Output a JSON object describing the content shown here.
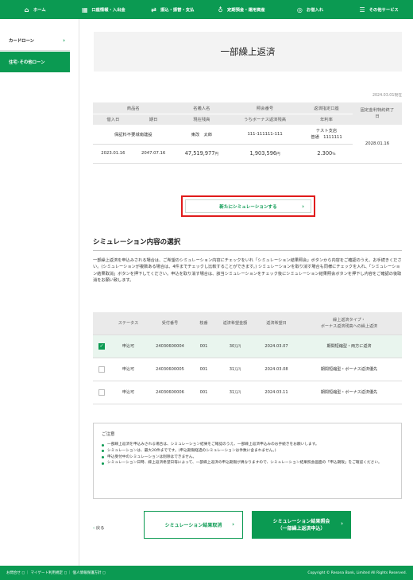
{
  "nav": [
    {
      "label": "ホーム",
      "icon": "home-icon",
      "glyph": "⌂"
    },
    {
      "label": "口座情報・入出金",
      "icon": "bank-icon",
      "glyph": "▦"
    },
    {
      "label": "振込・振替・支払",
      "icon": "transfer-icon",
      "glyph": "⇄"
    },
    {
      "label": "定期預金・運用資産",
      "icon": "savings-icon",
      "glyph": "♁"
    },
    {
      "label": "お借入れ",
      "icon": "loan-icon",
      "glyph": "◎"
    },
    {
      "label": "その他サービス",
      "icon": "services-icon",
      "glyph": "☰"
    }
  ],
  "sidebar": {
    "items": [
      {
        "label": "カードローン"
      },
      {
        "label": "住宅･その他ローン"
      }
    ]
  },
  "page_title": "一部繰上返済",
  "as_of": "2024.03.01現在",
  "loan_table": {
    "headers_row1": [
      "商品名",
      "名義人名",
      "照会番号",
      "返済指定口座",
      "固定金利特約終了日"
    ],
    "headers_row2": [
      "借入日",
      "期日",
      "現在残高",
      "うちボーナス返済残高",
      "年利率"
    ],
    "product": "保証料不要城南建設",
    "holder": "東改　太郎",
    "ref_no": "111-111111-111",
    "account_line1": "テスト支店",
    "account_line2": "普通　1111111",
    "fixed_end": "2028.01.16",
    "borrow_date": "2023.01.16",
    "due_date": "2047.07.16",
    "balance": "47,519,977",
    "bonus_balance": "1,903,596",
    "rate": "2.300",
    "unit_yen": "円",
    "unit_pct": "%"
  },
  "new_sim_button": "新たにシミュレーションする",
  "section_title": "シミュレーション内容の選択",
  "description": "一部繰上返済を申込みされる場合は、ご希望のシミュレーション内容にチェックをいれ「シミュレーション結果照会」ボタンから内容をご確認のうえ、お手続きください。(シミュレーションが複数ある場合は、4件までチェックし比較することができます。) シミュレーションを取り消す場合も同様にチェックを入れ、「シミュレーション結果取消」ボタンを押下してください。申込を取り消す場合は、該当シミュレーションをチェック後にシミュレーション結果照会ボタンを押下し内容をご確認の後取消をお願い致します。",
  "sim_table": {
    "headers": [
      "ステータス",
      "受付番号",
      "枝番",
      "返済希望金額",
      "返済希望日",
      "繰上返済タイプ・\nボーナス返済残高への繰上返済"
    ],
    "rows": [
      {
        "checked": true,
        "status": "申込可",
        "ref": "24030600004",
        "branch": "001",
        "amount": "30",
        "unit": "万円",
        "date": "2024.03.07",
        "type": "期間短縮型・両方に返済"
      },
      {
        "checked": false,
        "status": "申込可",
        "ref": "24030600005",
        "branch": "001",
        "amount": "31",
        "unit": "万円",
        "date": "2024.03.08",
        "type": "期間短縮型・ボーナス返済優先"
      },
      {
        "checked": false,
        "status": "申込可",
        "ref": "24030600006",
        "branch": "001",
        "amount": "31",
        "unit": "万円",
        "date": "2024.03.11",
        "type": "期間短縮型・ボーナス返済優先"
      }
    ]
  },
  "notice": {
    "title": "ご注意",
    "items": [
      "一部繰上返済を申込みされる場合は、シミュレーション結果をご確認のうえ、一部繰上返済申込みのお手続きをお願いします。",
      "シミュレーションは、最大20件までです。(申込期限経過のシミュレーションは件数に含まれません。)",
      "申込受付中のシミュレーションは削除はできません。",
      "シミュレーション日時、繰上返済希望日等によって、一部繰上返済の申込期限が異なりますので、シミュレーション結果照会画面の「申込期限」をご確認ください。"
    ]
  },
  "back_label": "戻る",
  "cancel_button": "シミュレーション結果取消",
  "inquiry_button_line1": "シミュレーション結果照会",
  "inquiry_button_line2": "（一部繰上返済申込）",
  "footer": {
    "left": "お問合せ ◻︎ ｜ マイゲート利用規定 ◻︎ ｜ 個人情報保護方針 ◻︎",
    "right": "Copyright © Resona Bank, Limited All Rights Reserved."
  }
}
